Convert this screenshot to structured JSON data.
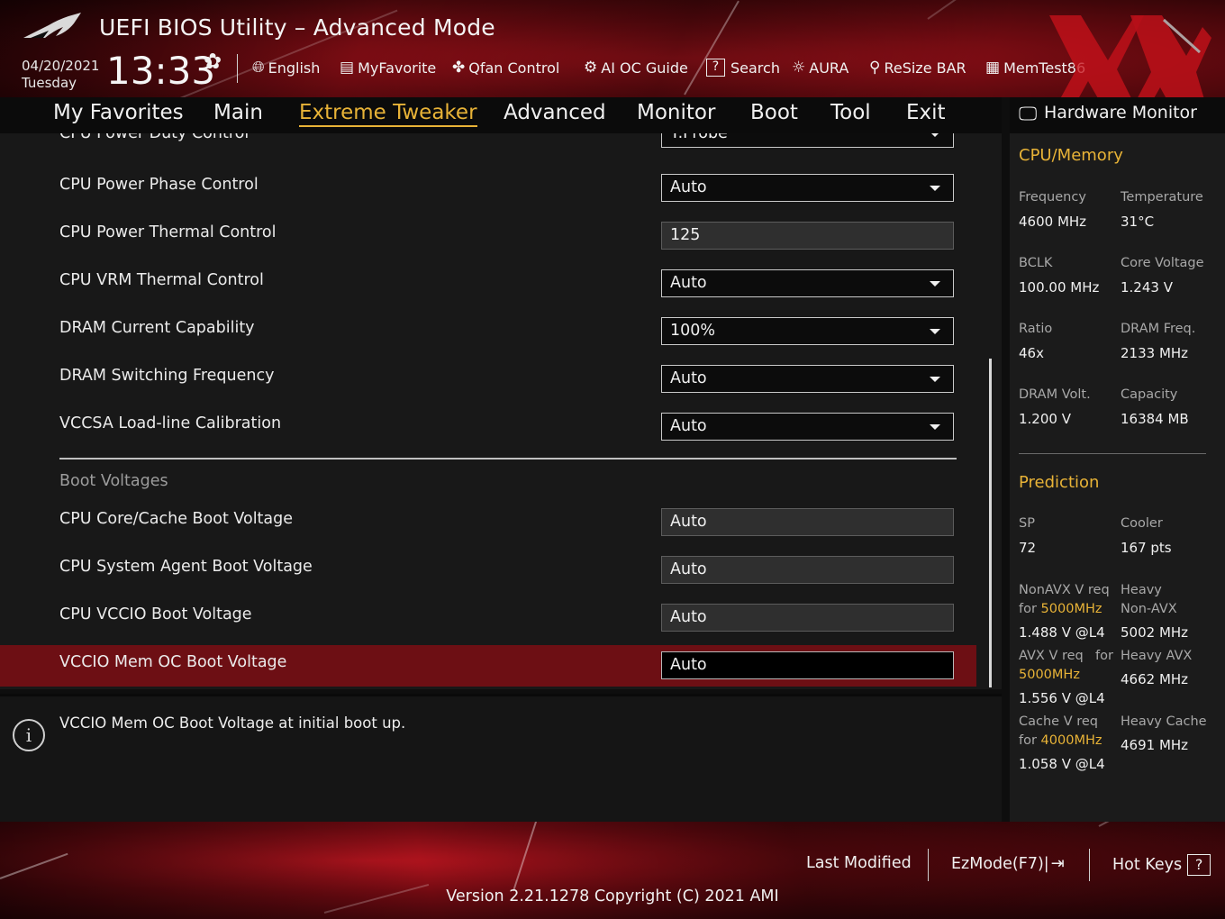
{
  "header": {
    "title": "UEFI BIOS Utility – Advanced Mode",
    "date": "04/20/2021",
    "day": "Tuesday",
    "time": "13:33",
    "tools": [
      {
        "label": "English",
        "icon": "globe-icon"
      },
      {
        "label": "MyFavorite",
        "icon": "favorite-list-icon"
      },
      {
        "label": "Qfan Control",
        "icon": "fan-icon"
      },
      {
        "label": "AI OC Guide",
        "icon": "ai-chip-icon"
      },
      {
        "label": "Search",
        "icon": "help-question-icon"
      },
      {
        "label": "AURA",
        "icon": "aura-light-icon"
      },
      {
        "label": "ReSize BAR",
        "icon": "resize-bar-icon"
      },
      {
        "label": "MemTest86",
        "icon": "memory-icon"
      }
    ]
  },
  "nav": {
    "tabs": [
      "My Favorites",
      "Main",
      "Extreme Tweaker",
      "Advanced",
      "Monitor",
      "Boot",
      "Tool",
      "Exit"
    ],
    "active": "Extreme Tweaker"
  },
  "settings": {
    "rows": [
      {
        "label": "CPU Power Duty Control",
        "value": "T.Probe",
        "type": "dropdown"
      },
      {
        "label": "CPU Power Phase Control",
        "value": "Auto",
        "type": "dropdown"
      },
      {
        "label": "CPU Power Thermal Control",
        "value": "125",
        "type": "readonly"
      },
      {
        "label": "CPU VRM Thermal Control",
        "value": "Auto",
        "type": "dropdown"
      },
      {
        "label": "DRAM Current Capability",
        "value": "100%",
        "type": "dropdown"
      },
      {
        "label": "DRAM Switching Frequency",
        "value": "Auto",
        "type": "dropdown"
      },
      {
        "label": "VCCSA Load-line Calibration",
        "value": "Auto",
        "type": "dropdown"
      }
    ],
    "section_label": "Boot Voltages",
    "boot_rows": [
      {
        "label": "CPU Core/Cache Boot Voltage",
        "value": "Auto"
      },
      {
        "label": "CPU System Agent Boot Voltage",
        "value": "Auto"
      },
      {
        "label": "CPU VCCIO Boot Voltage",
        "value": "Auto"
      },
      {
        "label": "VCCIO Mem OC Boot Voltage",
        "value": "Auto"
      }
    ]
  },
  "help": {
    "text": "VCCIO Mem OC Boot Voltage at initial boot up."
  },
  "hardware_monitor": {
    "title": "Hardware Monitor",
    "cpu_memory": {
      "heading": "CPU/Memory",
      "frequency_label": "Frequency",
      "frequency": "4600 MHz",
      "temperature_label": "Temperature",
      "temperature": "31°C",
      "bclk_label": "BCLK",
      "bclk": "100.00 MHz",
      "core_voltage_label": "Core Voltage",
      "core_voltage": "1.243 V",
      "ratio_label": "Ratio",
      "ratio": "46x",
      "dram_freq_label": "DRAM Freq.",
      "dram_freq": "2133 MHz",
      "dram_volt_label": "DRAM Volt.",
      "dram_volt": "1.200 V",
      "capacity_label": "Capacity",
      "capacity": "16384 MB"
    },
    "prediction": {
      "heading": "Prediction",
      "sp_label": "SP",
      "sp": "72",
      "cooler_label": "Cooler",
      "cooler": "167 pts",
      "nonavx_label_1": "NonAVX V req",
      "nonavx_label_2_prefix": "for ",
      "nonavx_freq": "5000MHz",
      "nonavx_value": "1.488 V @L4",
      "heavy_nonavx_label_1": "Heavy",
      "heavy_nonavx_label_2": "Non-AVX",
      "heavy_nonavx_value": "5002 MHz",
      "avx_label_1": "AVX V req",
      "avx_label_for": "for",
      "avx_freq": "5000MHz",
      "avx_value": "1.556 V @L4",
      "heavy_avx_label": "Heavy AVX",
      "heavy_avx_value": "4662 MHz",
      "cache_label_1": "Cache V req",
      "cache_label_2_prefix": "for ",
      "cache_freq": "4000MHz",
      "cache_value": "1.058 V @L4",
      "heavy_cache_label": "Heavy Cache",
      "heavy_cache_value": "4691 MHz"
    }
  },
  "footer": {
    "last_modified": "Last Modified",
    "ezmode": "EzMode(F7)|",
    "hot_keys": "Hot Keys",
    "hot_keys_symbol": "?",
    "version": "Version 2.21.1278 Copyright (C) 2021 AMI"
  },
  "colors": {
    "accent": "#e8b337",
    "selected_row": "#6d0f14",
    "brand_red": "#a5121b"
  }
}
